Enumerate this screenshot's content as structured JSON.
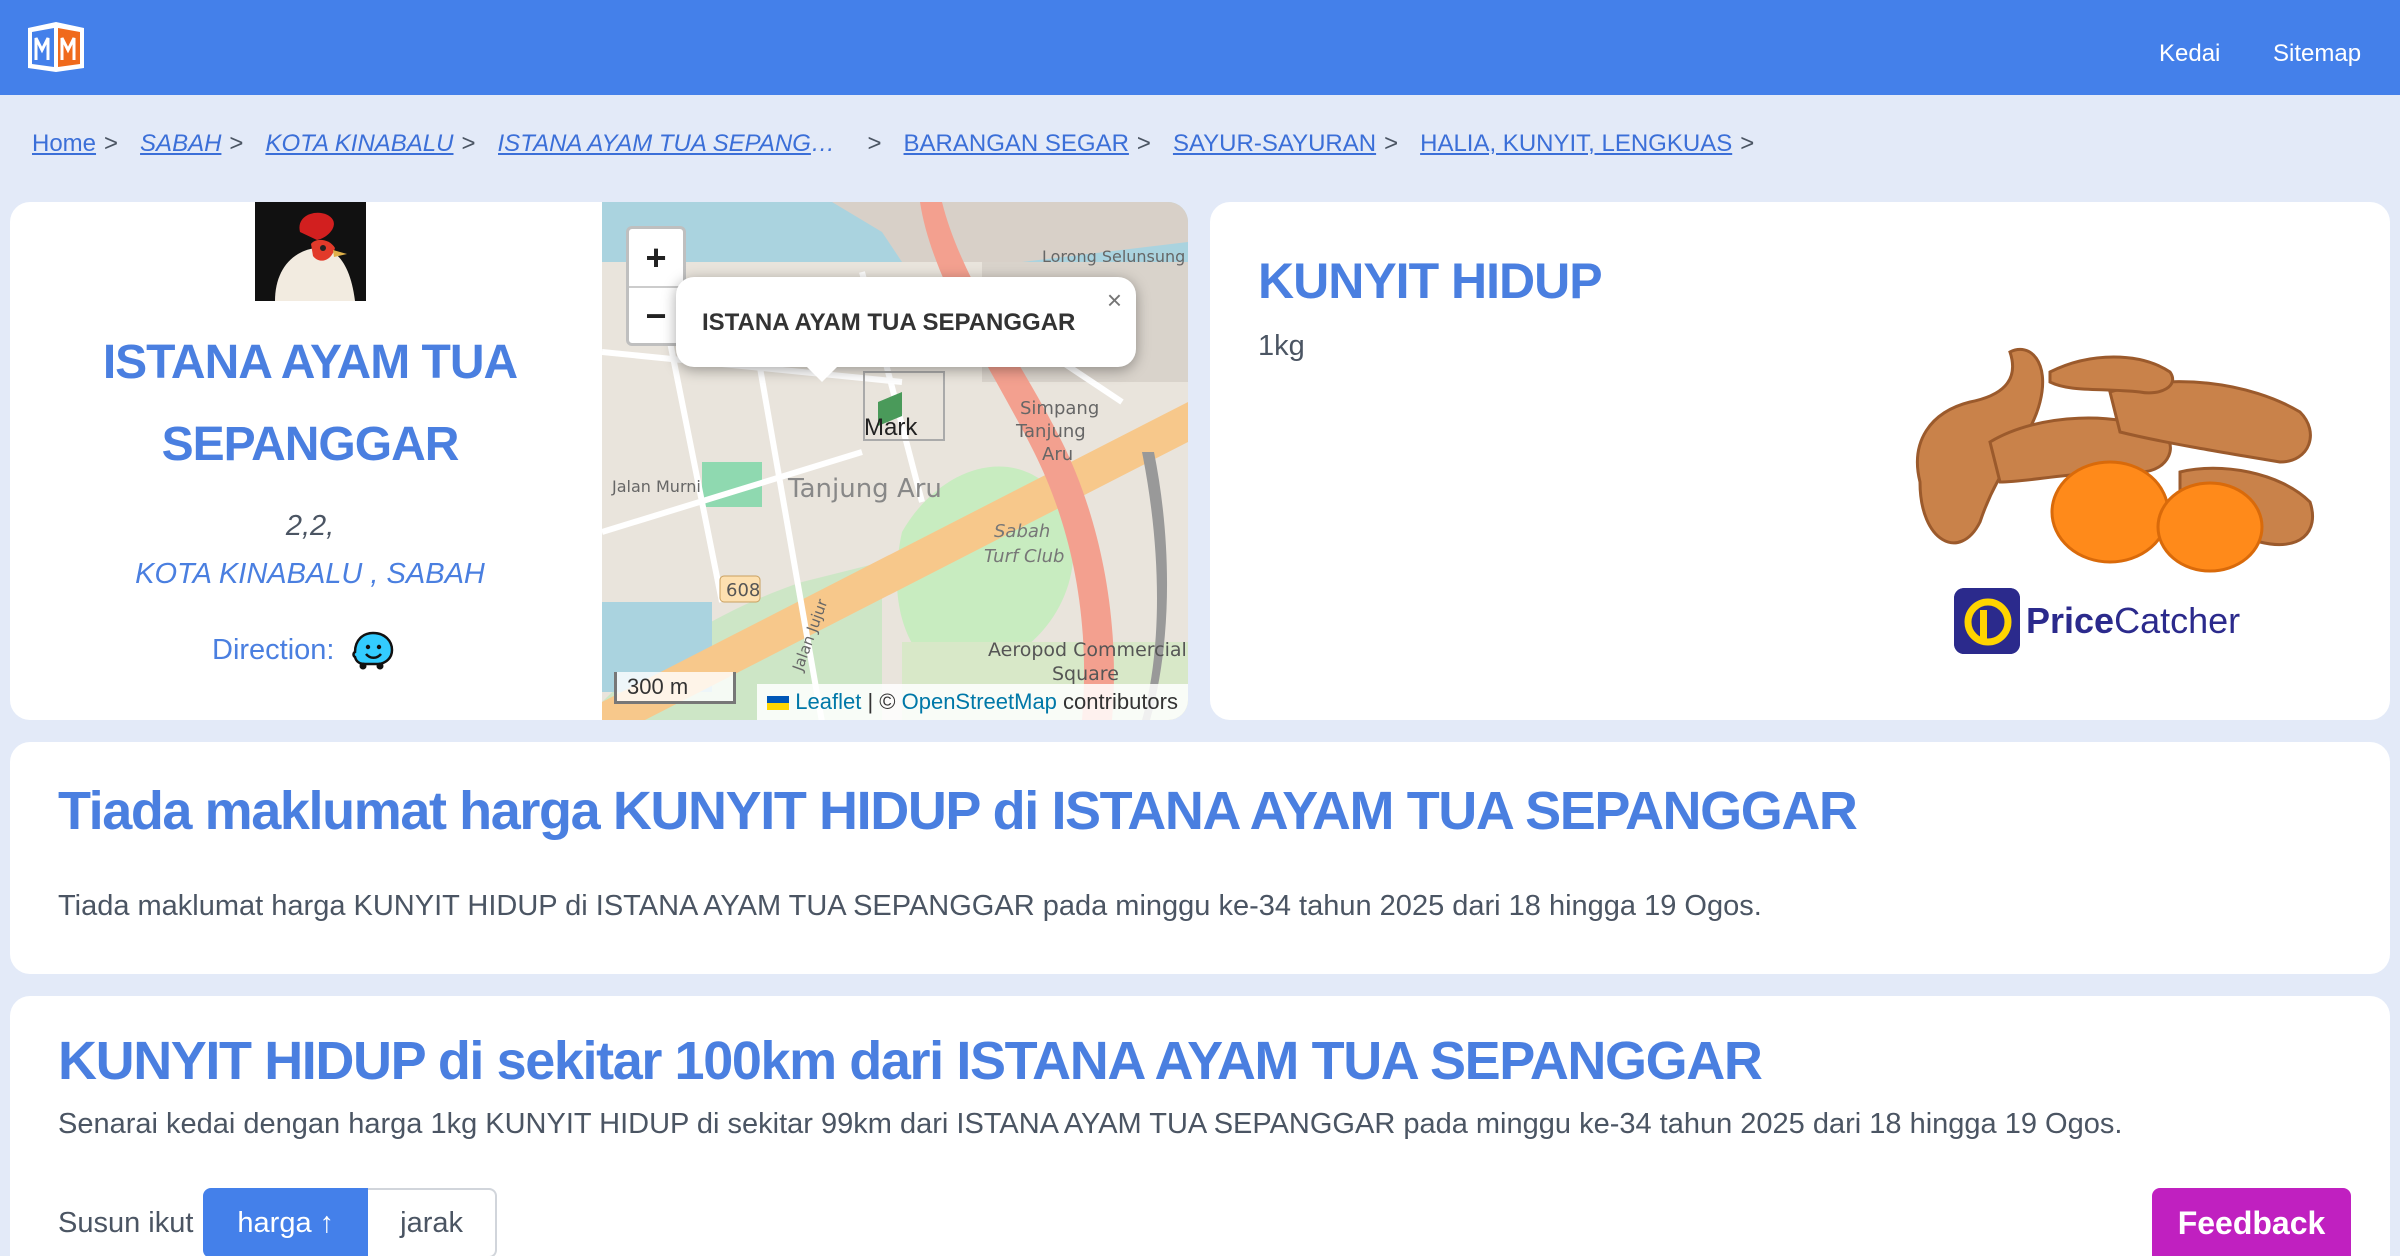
{
  "nav": {
    "links": [
      "Kedai",
      "Sitemap"
    ],
    "brand_color": "#4480ea"
  },
  "breadcrumb": {
    "items": [
      "Home",
      "SABAH",
      "KOTA KINABALU",
      "ISTANA AYAM TUA SEPANGGAR",
      "BARANGAN SEGAR",
      "SAYUR-SAYURAN",
      "HALIA, KUNYIT, LENGKUAS"
    ],
    "separator": ">"
  },
  "store": {
    "name": "ISTANA AYAM TUA SEPANGGAR",
    "address_line1": "2,2,",
    "address_line2": "KOTA KINABALU , SABAH",
    "direction_label": "Direction:"
  },
  "map": {
    "zoom_in": "+",
    "zoom_out": "−",
    "popup_title": "ISTANA AYAM TUA SEPANGGAR",
    "popup_close": "×",
    "marker_label": "Mark",
    "scale": "300 m",
    "attribution_leaflet": "Leaflet",
    "attribution_mid": "| ©",
    "attribution_osm": "OpenStreetMap",
    "attribution_end": "contributors",
    "place_labels": [
      "Tanjung Aru",
      "Sabah Turf Club",
      "Simpang Tanjung Aru",
      "Aeropod Commercial Square",
      "Lorong Selunsung",
      "Jalan Murni",
      "608",
      "Jalan Jujur"
    ]
  },
  "product": {
    "name": "KUNYIT HIDUP",
    "quantity": "1kg",
    "brand_prefix": "Price",
    "brand_suffix": "Catcher"
  },
  "noinfo": {
    "title": "Tiada maklumat harga KUNYIT HIDUP di ISTANA AYAM TUA SEPANGGAR",
    "text": "Tiada maklumat harga KUNYIT HIDUP di ISTANA AYAM TUA SEPANGGAR pada minggu ke-34 tahun 2025 dari 18 hingga 19 Ogos."
  },
  "nearby": {
    "title": "KUNYIT HIDUP di sekitar 100km dari ISTANA AYAM TUA SEPANGGAR",
    "text": "Senarai kedai dengan harga 1kg KUNYIT HIDUP di sekitar 99km dari ISTANA AYAM TUA SEPANGGAR pada minggu ke-34 tahun 2025 dari 18 hingga 19 Ogos.",
    "sort_label": "Susun ikut",
    "sort_options": [
      "harga ↑",
      "jarak"
    ],
    "sort_selected": "harga ↑"
  },
  "feedback": {
    "label": "Feedback",
    "color": "#c020c0"
  }
}
